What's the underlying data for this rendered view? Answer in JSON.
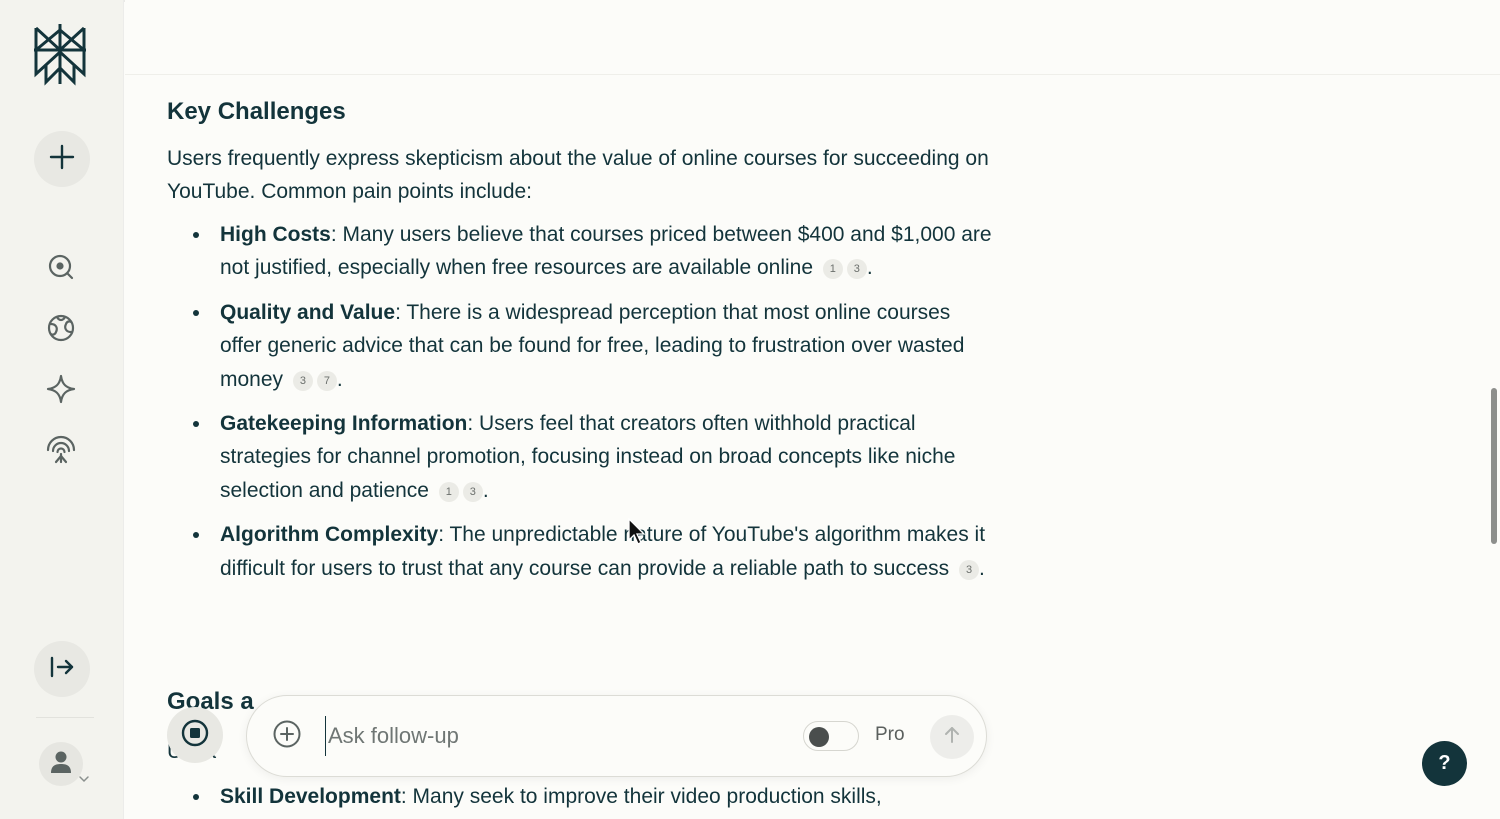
{
  "sidebar": {
    "logo": "perplexity-logo",
    "new_thread_icon": "plus-icon",
    "nav": [
      {
        "name": "home",
        "icon": "search-circle-icon"
      },
      {
        "name": "discover",
        "icon": "globe-icon"
      },
      {
        "name": "spaces",
        "icon": "sparkle-icon"
      },
      {
        "name": "library",
        "icon": "broadcast-icon"
      }
    ],
    "collapse_icon": "arrow-right-to-bar-icon",
    "account_icon": "user-icon"
  },
  "main": {
    "section_title": "Key Challenges",
    "intro": "Users frequently express skepticism about the value of online courses for succeeding on YouTube. Common pain points include:",
    "items": [
      {
        "term": "High Costs",
        "text": ": Many users believe that courses priced between $400 and $1,000 are not justified, especially when free resources are available online",
        "citations": [
          "1",
          "3"
        ],
        "end": "."
      },
      {
        "term": "Quality and Value",
        "text": ": There is a widespread perception that most online courses offer generic advice that can be found for free, leading to frustration over wasted money",
        "citations": [
          "3",
          "7"
        ],
        "end": "."
      },
      {
        "term": "Gatekeeping Information",
        "text": ": Users feel that creators often withhold practical strategies for channel promotion, focusing instead on broad concepts like niche selection and patience",
        "citations": [
          "1",
          "3"
        ],
        "end": "."
      },
      {
        "term": "Algorithm Complexity",
        "text": ": The unpredictable nature of YouTube's algorithm makes it difficult for users to trust that any course can provide a reliable path to success",
        "citations": [
          "3"
        ],
        "end": "."
      }
    ],
    "next_section_partial": "Goals a",
    "next_intro_partial": "U   s a",
    "next_item": {
      "term": "Skill Development",
      "text": ": Many seek to improve their video production skills,"
    }
  },
  "ask_bar": {
    "placeholder": "Ask follow-up",
    "value": "",
    "pro_label": "Pro",
    "pro_enabled": false,
    "attach_icon": "plus-circle-icon",
    "send_icon": "arrow-up-icon",
    "stop_icon": "stop-icon"
  },
  "help": {
    "label": "?"
  },
  "colors": {
    "text": "#13343b",
    "sidebar_bg": "#f3f3ee",
    "page_bg": "#fcfcf9",
    "help_bg": "#13343b"
  }
}
